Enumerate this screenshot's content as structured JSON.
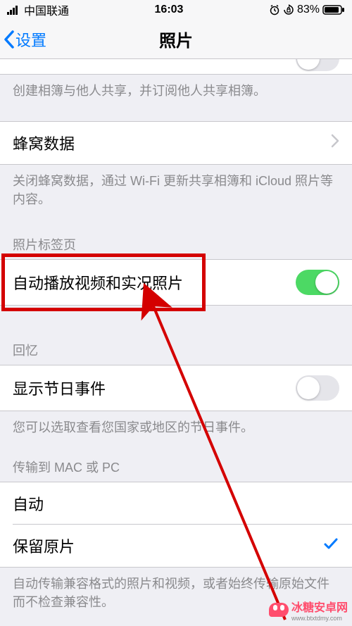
{
  "status": {
    "carrier": "中国联通",
    "time": "16:03",
    "battery_pct": "83%"
  },
  "nav": {
    "back_label": "设置",
    "title": "照片"
  },
  "shared_albums": {
    "footer": "创建相簿与他人共享，并订阅他人共享相簿。"
  },
  "cellular": {
    "label": "蜂窝数据",
    "footer": "关闭蜂窝数据，通过 Wi-Fi 更新共享相簿和 iCloud 照片等内容。"
  },
  "photos_tab": {
    "header": "照片标签页",
    "autoplay_label": "自动播放视频和实况照片",
    "autoplay_on": true
  },
  "memories": {
    "header": "回忆",
    "holiday_label": "显示节日事件",
    "holiday_on": false,
    "footer": "您可以选取查看您国家或地区的节日事件。"
  },
  "transfer": {
    "header": "传输到 MAC 或 PC",
    "auto_label": "自动",
    "keep_label": "保留原片",
    "selected": "keep",
    "footer": "自动传输兼容格式的照片和视频，或者始终传输原始文件而不检查兼容性。"
  },
  "watermark": {
    "text": "冰糖安卓网",
    "url": "www.btxtdmy.com"
  }
}
